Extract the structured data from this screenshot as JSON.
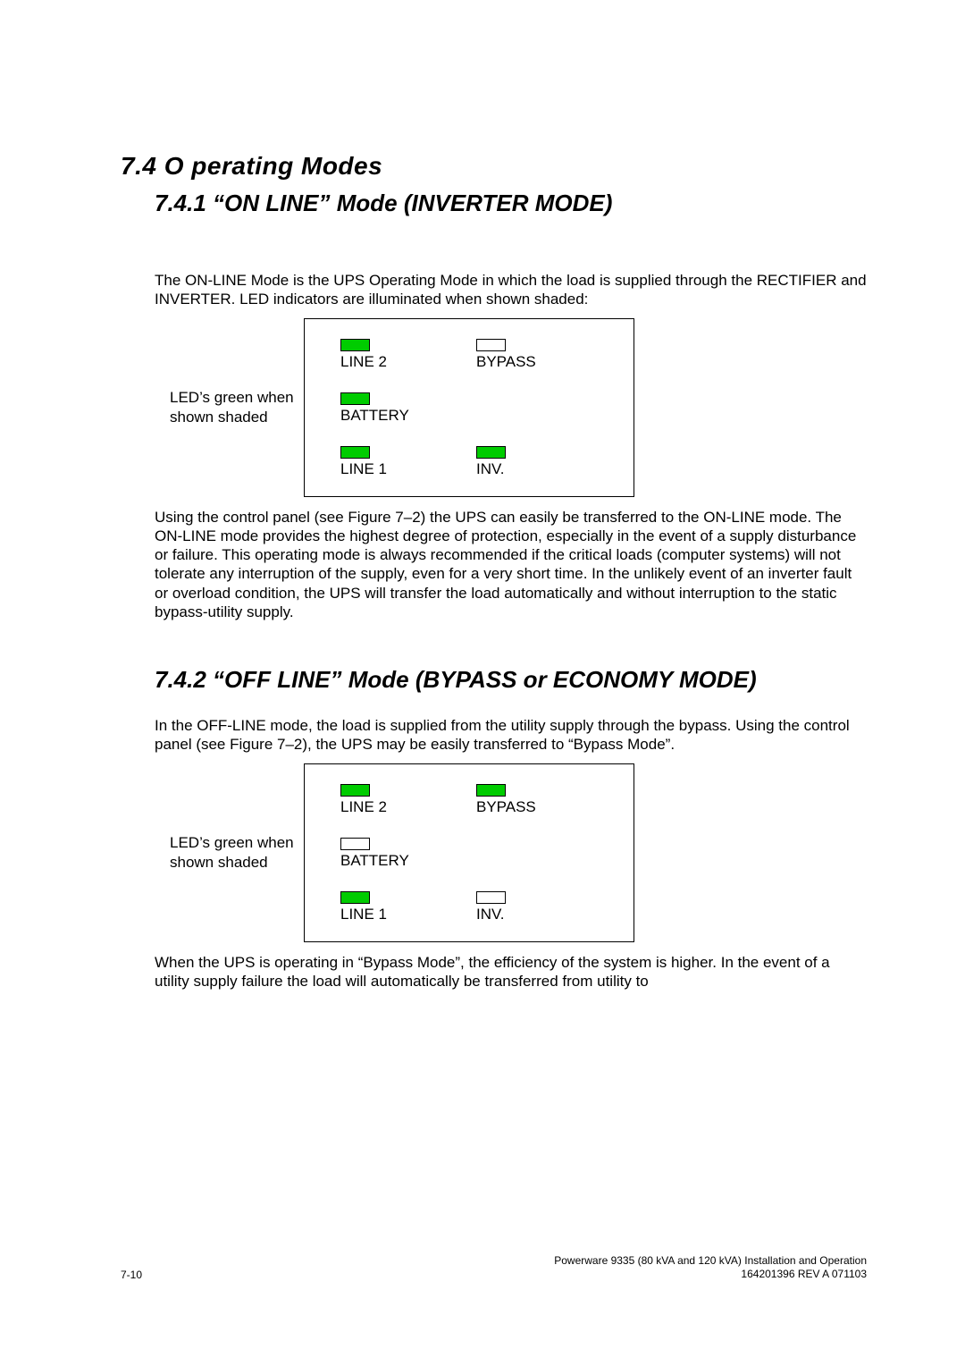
{
  "section": {
    "title": "7.4 O perating Modes",
    "sub1": {
      "title": "7.4.1  “ON LINE” Mode (INVERTER MODE)",
      "intro": "The ON-LINE Mode is the UPS Operating Mode in which the load is supplied through the RECTIFIER and INVERTER.  LED indicators are illuminated when shown shaded:",
      "note": "LED’s green when shown shaded",
      "leds": {
        "line2": {
          "label": "LINE 2",
          "on": true
        },
        "bypass": {
          "label": "BYPASS",
          "on": false
        },
        "battery": {
          "label": "BATTERY",
          "on": true
        },
        "line1": {
          "label": "LINE 1",
          "on": true
        },
        "inv": {
          "label": "INV.",
          "on": true
        }
      },
      "outro": "Using the control panel (see Figure 7–2) the UPS can easily be transferred to the ON-LINE mode.  The ON-LINE mode provides the highest degree of protection, especially in the event of a supply disturbance or failure.  This operating mode is always recommended if the critical loads (computer systems) will not tolerate any interruption of the supply, even for a very short time.  In the unlikely event of an inverter fault or overload condition, the UPS will transfer the load automatically and without interruption to the static bypass-utility supply."
    },
    "sub2": {
      "title": "7.4.2  “OFF LINE” Mode  (BYPASS or ECONOMY MODE)",
      "intro": "In the OFF-LINE mode, the load is supplied from the utility supply through the bypass. Using the control panel (see Figure 7–2), the UPS may be easily transferred to “Bypass Mode”.",
      "note": "LED’s green when shown shaded",
      "leds": {
        "line2": {
          "label": "LINE 2",
          "on": true
        },
        "bypass": {
          "label": "BYPASS",
          "on": true
        },
        "battery": {
          "label": "BATTERY",
          "on": false
        },
        "line1": {
          "label": "LINE 1",
          "on": true
        },
        "inv": {
          "label": "INV.",
          "on": false
        }
      },
      "outro": "When the UPS is operating in “Bypass Mode”, the efficiency of the system is higher.  In the event of a utility supply failure the load will automatically be transferred from utility to"
    }
  },
  "footer": {
    "page": "7-10",
    "right1": "Powerware 9335 (80 kVA and 120 kVA) Installation and Operation",
    "right2": "164201396 REV A  071103"
  }
}
